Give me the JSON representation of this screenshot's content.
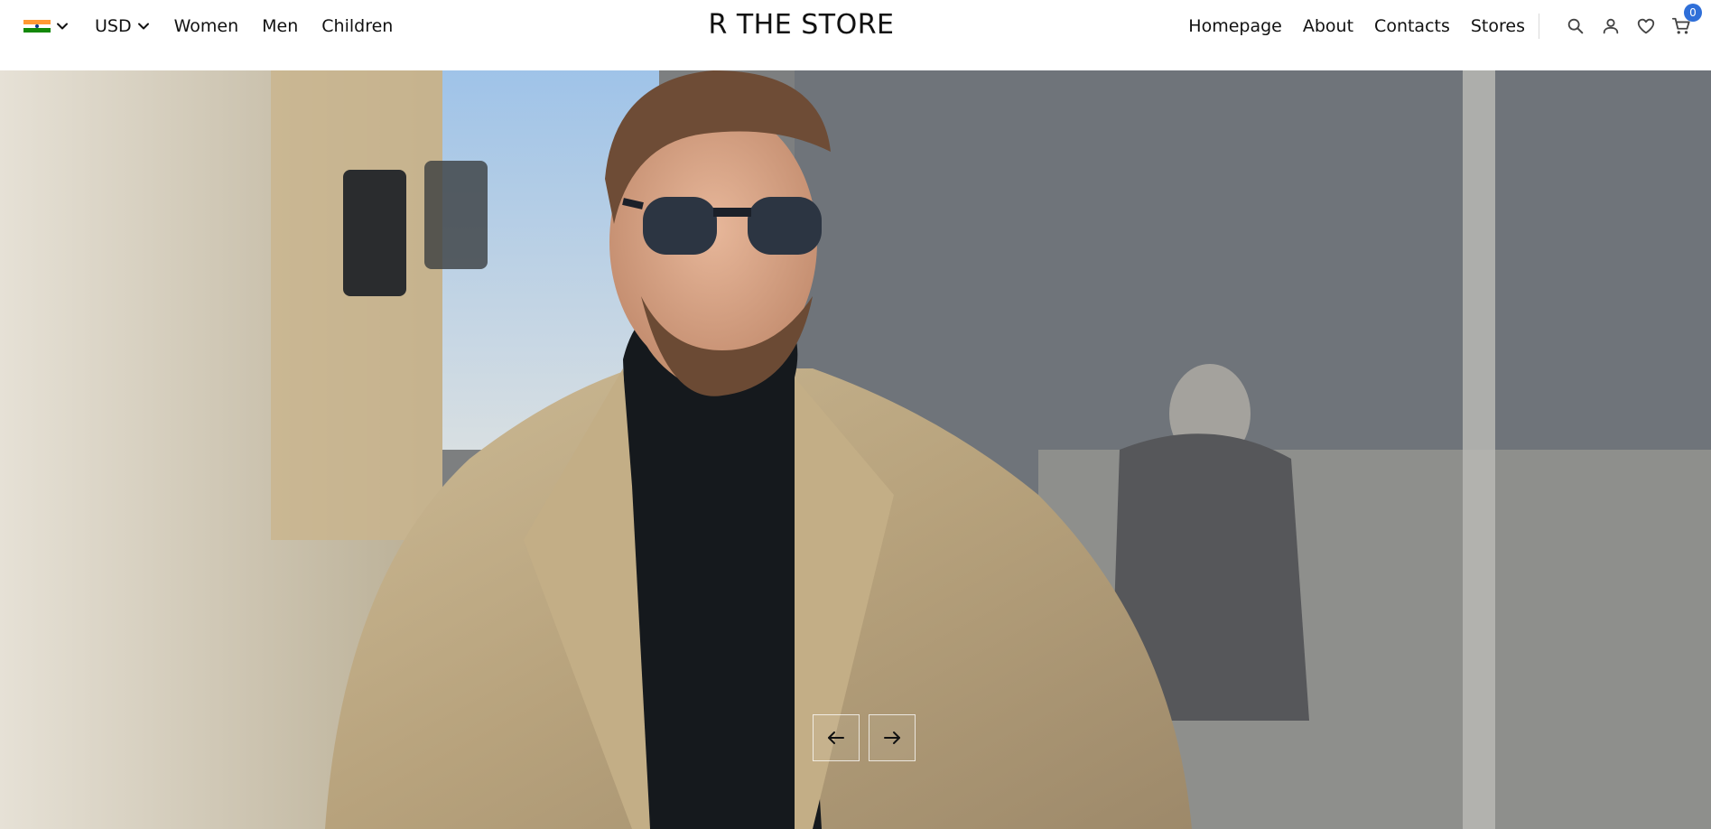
{
  "header": {
    "locale_flag": "india-flag-icon",
    "currency": "USD",
    "category_links": [
      "Women",
      "Men",
      "Children"
    ],
    "brand": "R THE STORE",
    "page_links": [
      "Homepage",
      "About",
      "Contacts",
      "Stores"
    ],
    "cart_count": "0",
    "icons": [
      "search-icon",
      "user-icon",
      "heart-icon",
      "cart-icon"
    ]
  },
  "hero": {
    "image": "man-in-camel-coat-and-sunglasses",
    "controls": [
      "arrow-left-icon",
      "arrow-right-icon"
    ]
  },
  "colors": {
    "badge": "#2f6fd8",
    "text": "#111111",
    "flag_saffron": "#ff9933",
    "flag_white": "#ffffff",
    "flag_green": "#138808"
  }
}
